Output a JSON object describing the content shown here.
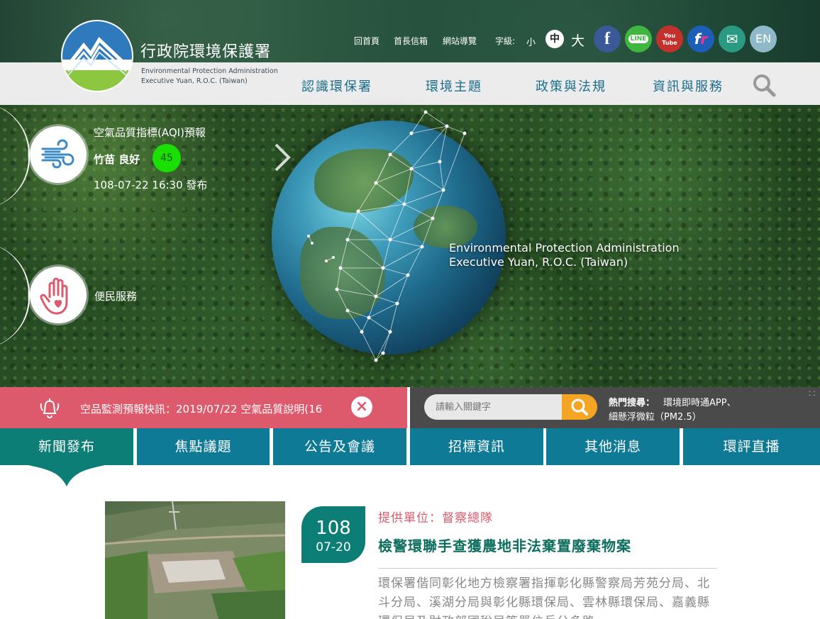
{
  "header": {
    "org_name": "行政院環境保護署",
    "org_en_line1": "Environmental Protection Administration",
    "org_en_line2": "Executive Yuan, R.O.C. (Taiwan)",
    "util_links": [
      "回首頁",
      "首長信箱",
      "網站導覽"
    ],
    "font_size_label": "字級:",
    "font_sizes": [
      "小",
      "中",
      "大"
    ],
    "social": {
      "facebook": "f",
      "line": "LINE",
      "youtube_top": "You",
      "youtube_bottom": "Tube",
      "flickr_f": "f",
      "flickr_r": "r",
      "mail": "✉",
      "en": "EN"
    },
    "nav": [
      "認識環保署",
      "環境主題",
      "政策與法規",
      "資訊與服務"
    ]
  },
  "hero": {
    "en_line1": "Environmental Protection Administration",
    "en_line2": "Executive Yuan, R.O.C. (Taiwan)",
    "aqi": {
      "title": "空氣品質指標(AQI)預報",
      "place": "竹苗 良好",
      "value": "45",
      "time": "108-07-22 16:30 發布",
      "status_color": "#19e000"
    },
    "service_label": "便民服務"
  },
  "notice": {
    "text": "空品監測預報快訊：2019/07/22 空氣品質說明(16",
    "close": "×"
  },
  "search": {
    "placeholder": "請輸入關鍵字",
    "hot_label": "熱門搜尋：",
    "hot_item1": "環境即時通APP、",
    "hot_item2": "細懸浮微粒（PM2.5）"
  },
  "tabs": [
    "新聞發布",
    "焦點議題",
    "公告及會議",
    "招標資訊",
    "其他消息",
    "環評直播"
  ],
  "news": {
    "date_year": "108",
    "date_md": "07-20",
    "provider": "提供單位：督察總隊",
    "title": "檢警環聯手查獲農地非法棄置廢棄物案",
    "body": "環保署偕同彰化地方檢察署指揮彰化縣警察局芳苑分局、北斗分局、溪湖分局與彰化縣環保局、雲林縣環保局、嘉義縣環保局及財政部國稅局等單位兵分多路"
  },
  "colors": {
    "accent_teal": "#0d7e76",
    "tab_blue": "#0e7a96",
    "notice_pink": "#dd5a6c",
    "search_orange": "#f5a524"
  }
}
